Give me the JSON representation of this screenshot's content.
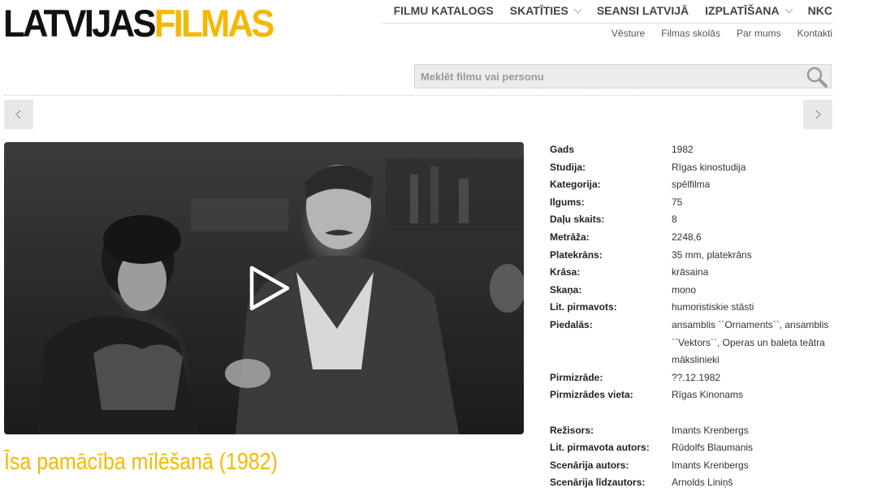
{
  "logo": {
    "part1": "LATVIJAS",
    "part2": "FILMAS"
  },
  "main_nav": [
    {
      "label": "FILMU KATALOGS",
      "dropdown": false
    },
    {
      "label": "SKATĪTIES",
      "dropdown": true
    },
    {
      "label": "SEANSI LATVIJĀ",
      "dropdown": false
    },
    {
      "label": "IZPLATĪŠANA",
      "dropdown": true
    },
    {
      "label": "NKC",
      "dropdown": false
    }
  ],
  "sub_nav": [
    "Vēsture",
    "Filmas skolās",
    "Par mums",
    "Kontakti"
  ],
  "search": {
    "placeholder": "Meklēt filmu vai personu",
    "value": ""
  },
  "film": {
    "title": "Īsa pamācība mīlēšanā (1982)"
  },
  "details": [
    {
      "label": "Gads",
      "value": "1982"
    },
    {
      "label": "Studija:",
      "value": "Rīgas kinostudija"
    },
    {
      "label": "Kategorija:",
      "value": "spēlfilma"
    },
    {
      "label": "Ilgums:",
      "value": "75"
    },
    {
      "label": "Daļu skaits:",
      "value": "8"
    },
    {
      "label": "Metrāža:",
      "value": "2248,6"
    },
    {
      "label": "Platekrāns:",
      "value": "35 mm, platekrāns"
    },
    {
      "label": "Krāsa:",
      "value": "krāsaina"
    },
    {
      "label": "Skaņa:",
      "value": "mono"
    },
    {
      "label": "Lit. pirmavots:",
      "value": "humoristiskie stāsti"
    },
    {
      "label": "Piedalās:",
      "value": "ansamblis ``Ornaments``, ansamblis ``Vektors``, Operas un baleta teātra mākslinieki"
    },
    {
      "label": "Pirmizrāde:",
      "value": "??.12.1982"
    },
    {
      "label": "Pirmizrādes vieta:",
      "value": "Rīgas Kinonams"
    }
  ],
  "crew": [
    {
      "label": "Režisors:",
      "value": "Imants Krenbergs"
    },
    {
      "label": "Lit. pirmavota autors:",
      "value": "Rūdolfs Blaumanis"
    },
    {
      "label": "Scenārija autors:",
      "value": "Imants Krenbergs"
    },
    {
      "label": "Scenārija līdzautors:",
      "value": "Arnolds Liniņš"
    }
  ],
  "colors": {
    "accent": "#f5b800",
    "logo_dark": "#111111"
  },
  "icons": {
    "search": "magnifier-icon",
    "play": "play-icon",
    "prev": "chevron-left-icon",
    "next": "chevron-right-icon"
  }
}
